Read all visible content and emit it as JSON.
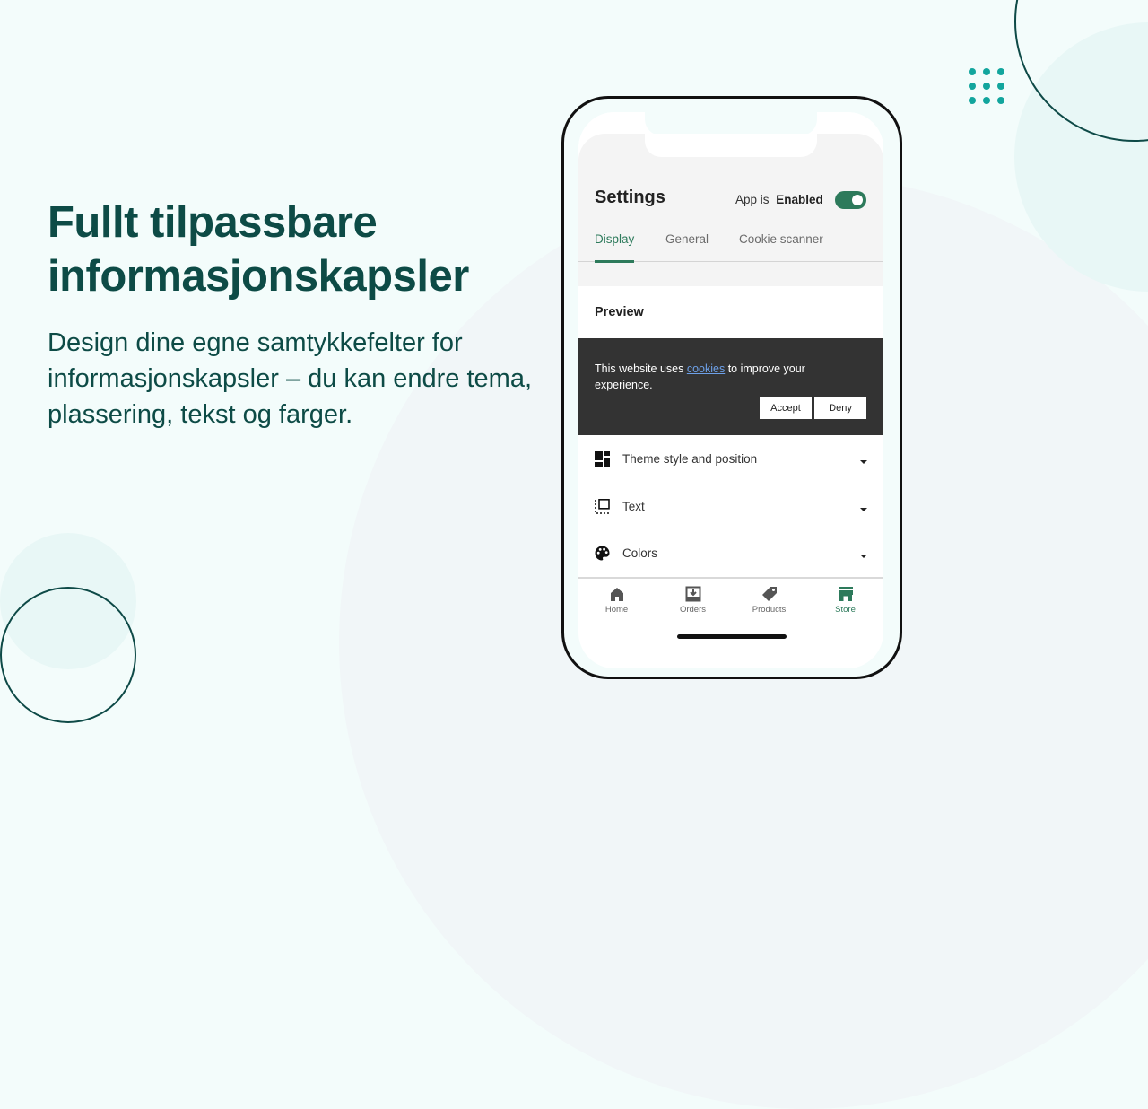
{
  "hero": {
    "title_line1": "Fullt tilpassbare",
    "title_line2": "informasjonskapsler",
    "description": "Design dine egne samtykkefelter for informasjonskapsler – du kan endre tema, plassering, tekst og farger."
  },
  "colors": {
    "brand_dark": "#0d4b46",
    "accent_teal": "#12a59d",
    "app_green": "#2d7a5b",
    "banner_bg": "#333333",
    "link_blue": "#6da0e8"
  },
  "app": {
    "header": {
      "title": "Settings",
      "status_prefix": "App is",
      "status_value": "Enabled",
      "toggle_on": true
    },
    "tabs": [
      {
        "label": "Display",
        "active": true
      },
      {
        "label": "General",
        "active": false
      },
      {
        "label": "Cookie scanner",
        "active": false
      }
    ],
    "preview": {
      "label": "Preview",
      "banner": {
        "text_before": "This website uses ",
        "link_text": "cookies",
        "text_after": " to improve your experience.",
        "accept_label": "Accept",
        "deny_label": "Deny"
      }
    },
    "accordion": [
      {
        "label": "Theme style and position",
        "icon": "dashboard-layout-icon"
      },
      {
        "label": "Text",
        "icon": "text-box-icon"
      },
      {
        "label": "Colors",
        "icon": "palette-icon"
      }
    ],
    "bottom_nav": [
      {
        "label": "Home",
        "icon": "home-icon",
        "active": false
      },
      {
        "label": "Orders",
        "icon": "orders-inbox-icon",
        "active": false
      },
      {
        "label": "Products",
        "icon": "tag-icon",
        "active": false
      },
      {
        "label": "Store",
        "icon": "store-icon",
        "active": true
      }
    ]
  }
}
